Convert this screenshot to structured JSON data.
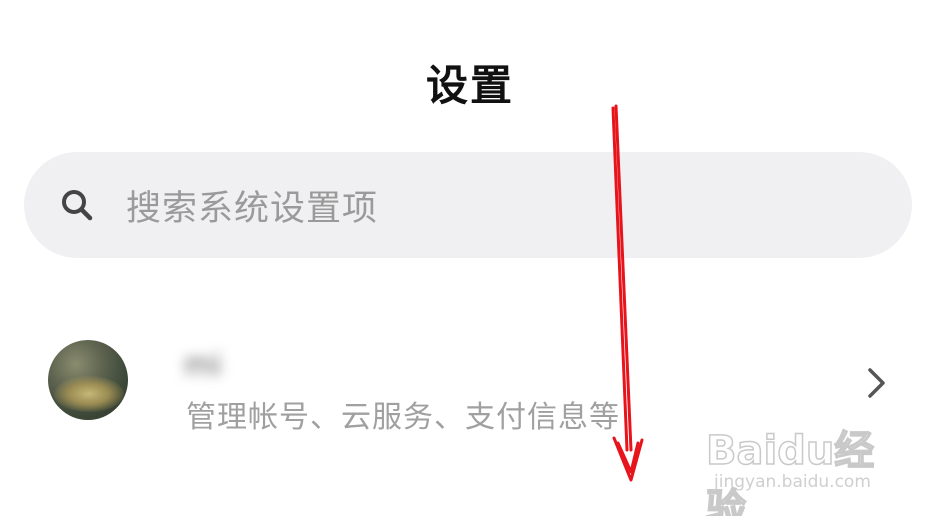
{
  "header": {
    "title": "设置"
  },
  "search": {
    "placeholder": "搜索系统设置项",
    "icon": "search-icon"
  },
  "account": {
    "name": "mi",
    "subtitle": "管理帐号、云服务、支付信息等",
    "chevron_icon": "chevron-right-icon"
  },
  "annotation": {
    "arrow_color": "#e8141c"
  },
  "watermark": {
    "logo_text": "Baidu经验",
    "url": "jingyan.baidu.com"
  }
}
